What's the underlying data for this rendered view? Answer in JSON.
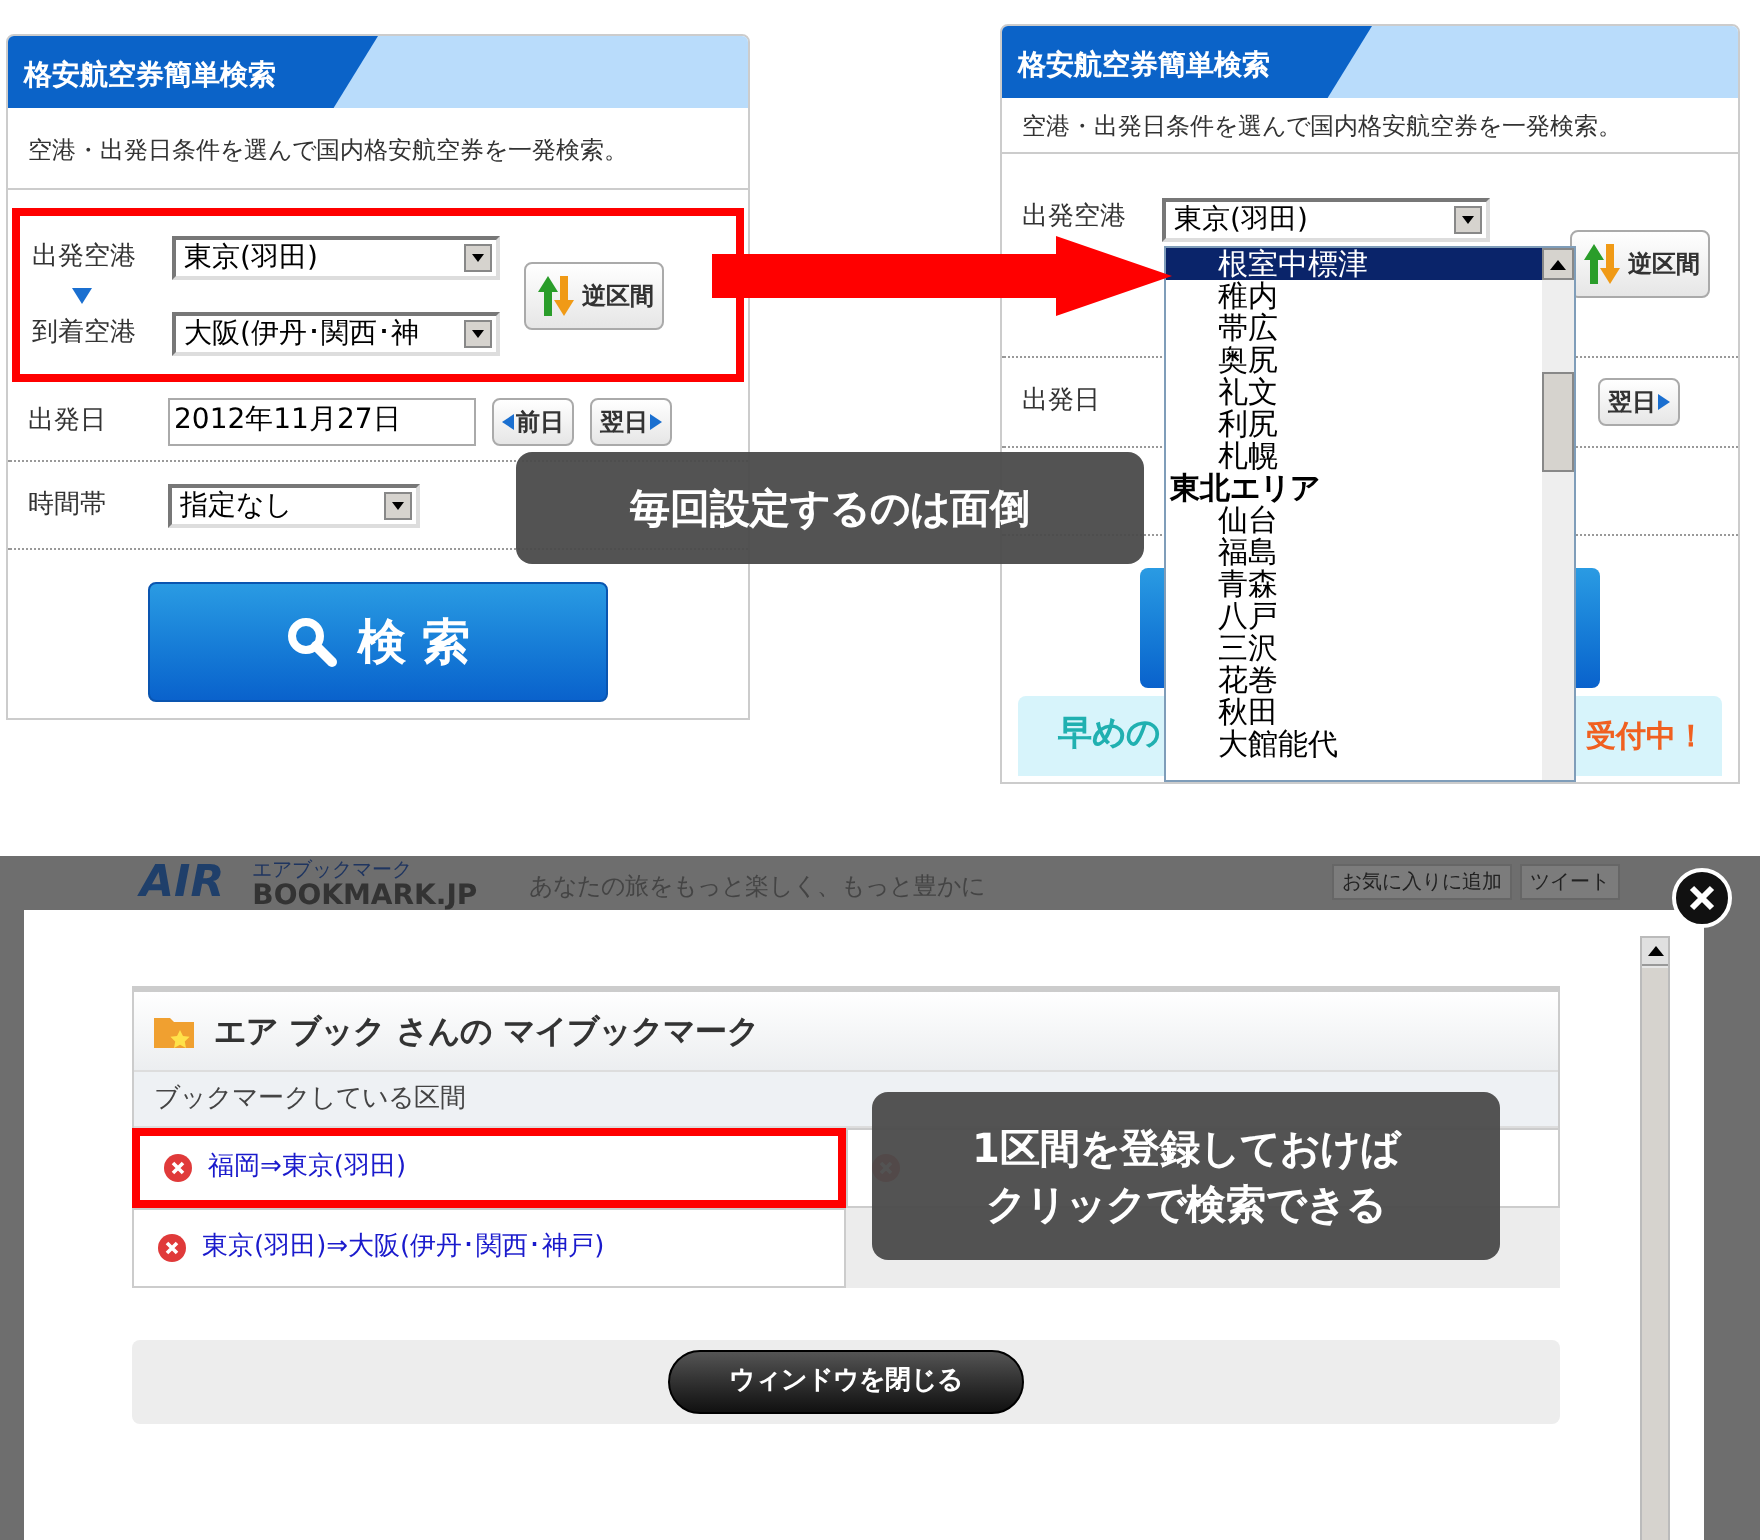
{
  "left_panel": {
    "title": "格安航空券簡単検索",
    "description": "空港・出発日条件を選んで国内格安航空券を一発検索。",
    "departure_label": "出発空港",
    "departure_value": "東京(羽田)",
    "arrival_label": "到着空港",
    "arrival_value": "大阪(伊丹･関西･神",
    "swap_button": "逆区間",
    "date_label": "出発日",
    "date_value": "2012年11月27日",
    "prev_button": "前日",
    "next_button": "翌日",
    "time_label": "時間帯",
    "time_value": "指定なし",
    "search_button": "検 索"
  },
  "right_panel": {
    "title": "格安航空券簡単検索",
    "description": "空港・出発日条件を選んで国内格安航空券を一発検索。",
    "departure_label": "出発空港",
    "departure_value": "東京(羽田)",
    "swap_button": "逆区間",
    "date_label": "出発日",
    "next_button": "翌日",
    "banner_left": "早めの",
    "banner_right": "受付中！",
    "dropdown": [
      {
        "kind": "airport",
        "label": "根室中標津",
        "selected": true
      },
      {
        "kind": "airport",
        "label": "稚内",
        "selected": false
      },
      {
        "kind": "airport",
        "label": "帯広",
        "selected": false
      },
      {
        "kind": "airport",
        "label": "奥尻",
        "selected": false
      },
      {
        "kind": "airport",
        "label": "礼文",
        "selected": false
      },
      {
        "kind": "airport",
        "label": "利尻",
        "selected": false
      },
      {
        "kind": "airport",
        "label": "札幌",
        "selected": false
      },
      {
        "kind": "area",
        "label": "東北エリア",
        "selected": false
      },
      {
        "kind": "airport",
        "label": "仙台",
        "selected": false
      },
      {
        "kind": "airport",
        "label": "福島",
        "selected": false
      },
      {
        "kind": "airport",
        "label": "青森",
        "selected": false
      },
      {
        "kind": "airport",
        "label": "八戸",
        "selected": false
      },
      {
        "kind": "airport",
        "label": "三沢",
        "selected": false
      },
      {
        "kind": "airport",
        "label": "花巻",
        "selected": false
      },
      {
        "kind": "airport",
        "label": "秋田",
        "selected": false
      },
      {
        "kind": "airport",
        "label": "大館能代",
        "selected": false
      }
    ]
  },
  "callouts": [
    {
      "lines": [
        "毎回設定するのは面倒"
      ]
    },
    {
      "lines": [
        "1区間を登録しておけば",
        "クリックで検索できる"
      ]
    }
  ],
  "site": {
    "logo_small": "エアブックマーク",
    "logo": "AIR",
    "logo_sub": "BOOKMARK.JP",
    "tagline": "あなたの旅をもっと楽しく、もっと豊かに",
    "buttons": [
      "お気に入りに追加",
      "ツイート"
    ]
  },
  "modal": {
    "title": "エア ブック さんの マイブックマーク",
    "subheader": "ブックマークしている区間",
    "bookmarks": [
      {
        "label": "福岡⇒東京(羽田)",
        "highlighted": true
      },
      {
        "label": "東京(羽田)⇒大阪(伊丹･関西･神戸)",
        "highlighted": false
      }
    ],
    "close_window_button": "ウィンドウを閉じる"
  }
}
